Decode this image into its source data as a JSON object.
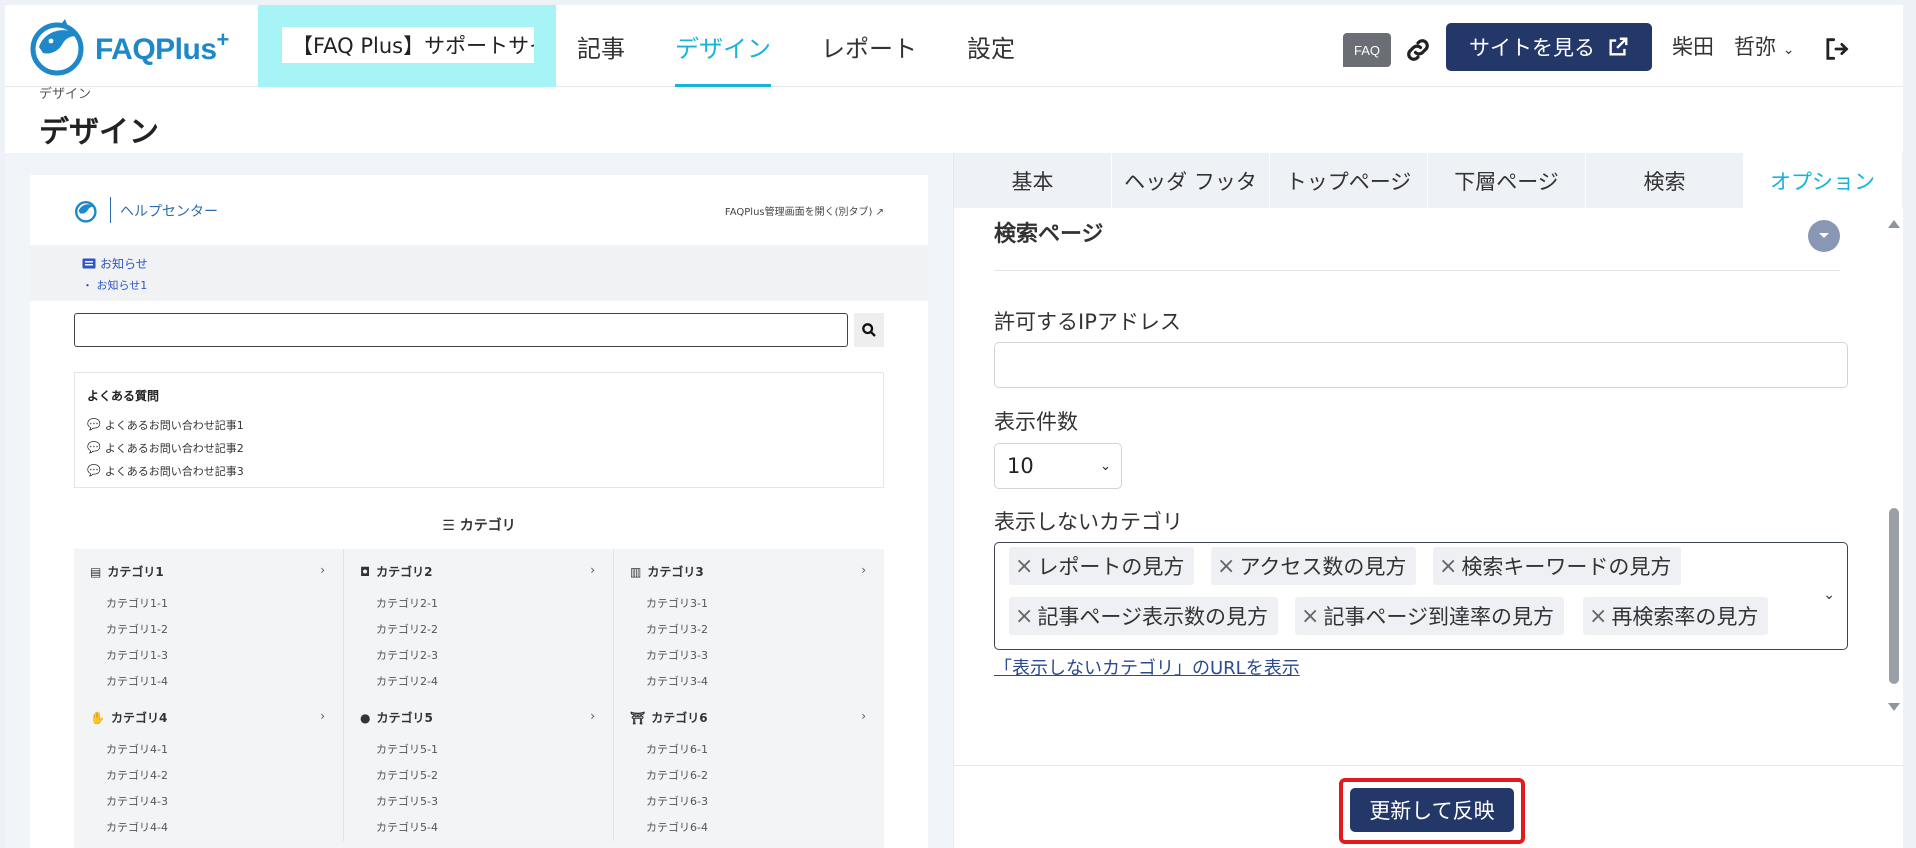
{
  "header": {
    "logo_text": "FAQPlus",
    "logo_plus": "+",
    "site_selector": "【FAQ Plus】サポートサイト",
    "nav": [
      {
        "label": "記事",
        "active": false
      },
      {
        "label": "デザイン",
        "active": true
      },
      {
        "label": "レポート",
        "active": false
      },
      {
        "label": "設定",
        "active": false
      }
    ],
    "faq_badge": "FAQ",
    "view_site_label": "サイトを見る",
    "user_last": "柴田",
    "user_first": "哲弥"
  },
  "page": {
    "breadcrumb": "デザイン",
    "title": "デザイン"
  },
  "preview": {
    "help_center": "ヘルプセンター",
    "admin_link": "FAQPlus管理画面を開く(別タブ)",
    "news_title": "お知らせ",
    "news_item": "お知らせ1",
    "faq_title": "よくある質問",
    "faq_items": [
      "よくあるお問い合わせ記事1",
      "よくあるお問い合わせ記事2",
      "よくあるお問い合わせ記事3"
    ],
    "category_title": "カテゴリ",
    "categories": [
      {
        "name": "カテゴリ1",
        "subs": [
          "カテゴリ1-1",
          "カテゴリ1-2",
          "カテゴリ1-3",
          "カテゴリ1-4"
        ]
      },
      {
        "name": "カテゴリ2",
        "subs": [
          "カテゴリ2-1",
          "カテゴリ2-2",
          "カテゴリ2-3",
          "カテゴリ2-4"
        ]
      },
      {
        "name": "カテゴリ3",
        "subs": [
          "カテゴリ3-1",
          "カテゴリ3-2",
          "カテゴリ3-3",
          "カテゴリ3-4"
        ]
      },
      {
        "name": "カテゴリ4",
        "subs": [
          "カテゴリ4-1",
          "カテゴリ4-2",
          "カテゴリ4-3",
          "カテゴリ4-4"
        ]
      },
      {
        "name": "カテゴリ5",
        "subs": [
          "カテゴリ5-1",
          "カテゴリ5-2",
          "カテゴリ5-3",
          "カテゴリ5-4"
        ]
      },
      {
        "name": "カテゴリ6",
        "subs": [
          "カテゴリ6-1",
          "カテゴリ6-2",
          "カテゴリ6-3",
          "カテゴリ6-4"
        ]
      }
    ]
  },
  "panel": {
    "tabs": [
      {
        "label": "基本",
        "active": false
      },
      {
        "label": "ヘッダ フッタ",
        "active": false
      },
      {
        "label": "トップページ",
        "active": false
      },
      {
        "label": "下層ページ",
        "active": false
      },
      {
        "label": "検索",
        "active": false
      },
      {
        "label": "オプション",
        "active": true
      }
    ],
    "section_title": "検索ページ",
    "ip_label": "許可するIPアドレス",
    "ip_value": "",
    "count_label": "表示件数",
    "count_value": "10",
    "hidden_cat_label": "表示しないカテゴリ",
    "hidden_categories": [
      "レポートの見方",
      "アクセス数の見方",
      "検索キーワードの見方",
      "記事ページ表示数の見方",
      "記事ページ到達率の見方",
      "再検索率の見方"
    ],
    "url_link": "「表示しないカテゴリ」のURLを表示",
    "update_label": "更新して反映"
  },
  "colors": {
    "accent": "#17b4d8",
    "primary": "#233869",
    "site_selector_bg": "#a7f4f6",
    "highlight": "#e11b1b"
  }
}
